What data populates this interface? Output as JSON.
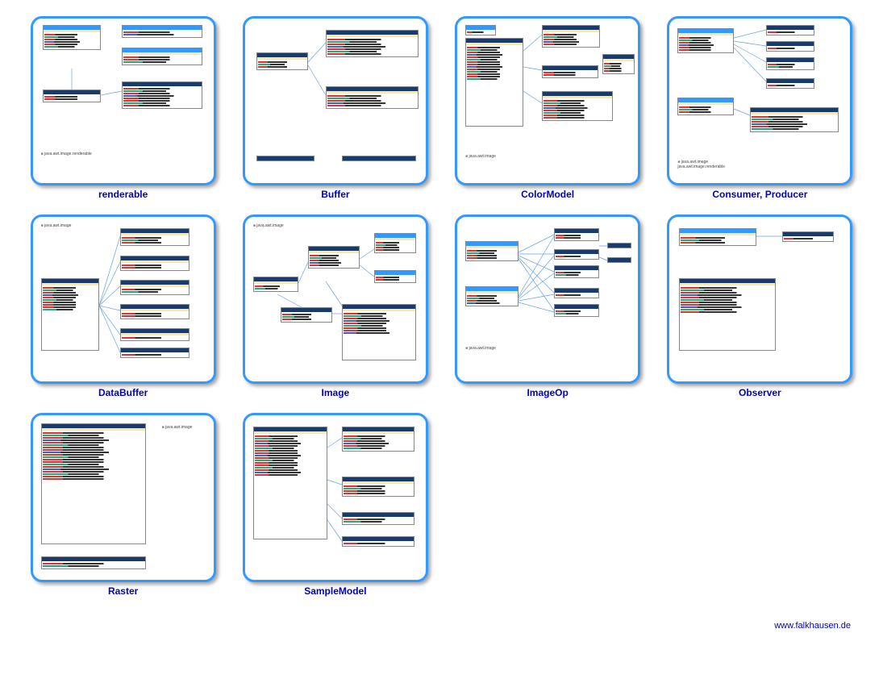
{
  "thumbnails": [
    {
      "label": "renderable",
      "package": "java.awt.image.renderable"
    },
    {
      "label": "Buffer",
      "package": ""
    },
    {
      "label": "ColorModel",
      "package": "java.awt.image"
    },
    {
      "label": "Consumer, Producer",
      "package": "java.awt.image\njava.awt.image.renderable"
    },
    {
      "label": "DataBuffer",
      "package": "java.awt.image"
    },
    {
      "label": "Image",
      "package": "java.awt.image"
    },
    {
      "label": "ImageOp",
      "package": "java.awt.image"
    },
    {
      "label": "Observer",
      "package": ""
    },
    {
      "label": "Raster",
      "package": "java.awt.image"
    },
    {
      "label": "SampleModel",
      "package": ""
    }
  ],
  "footer": "www.falkhausen.de"
}
